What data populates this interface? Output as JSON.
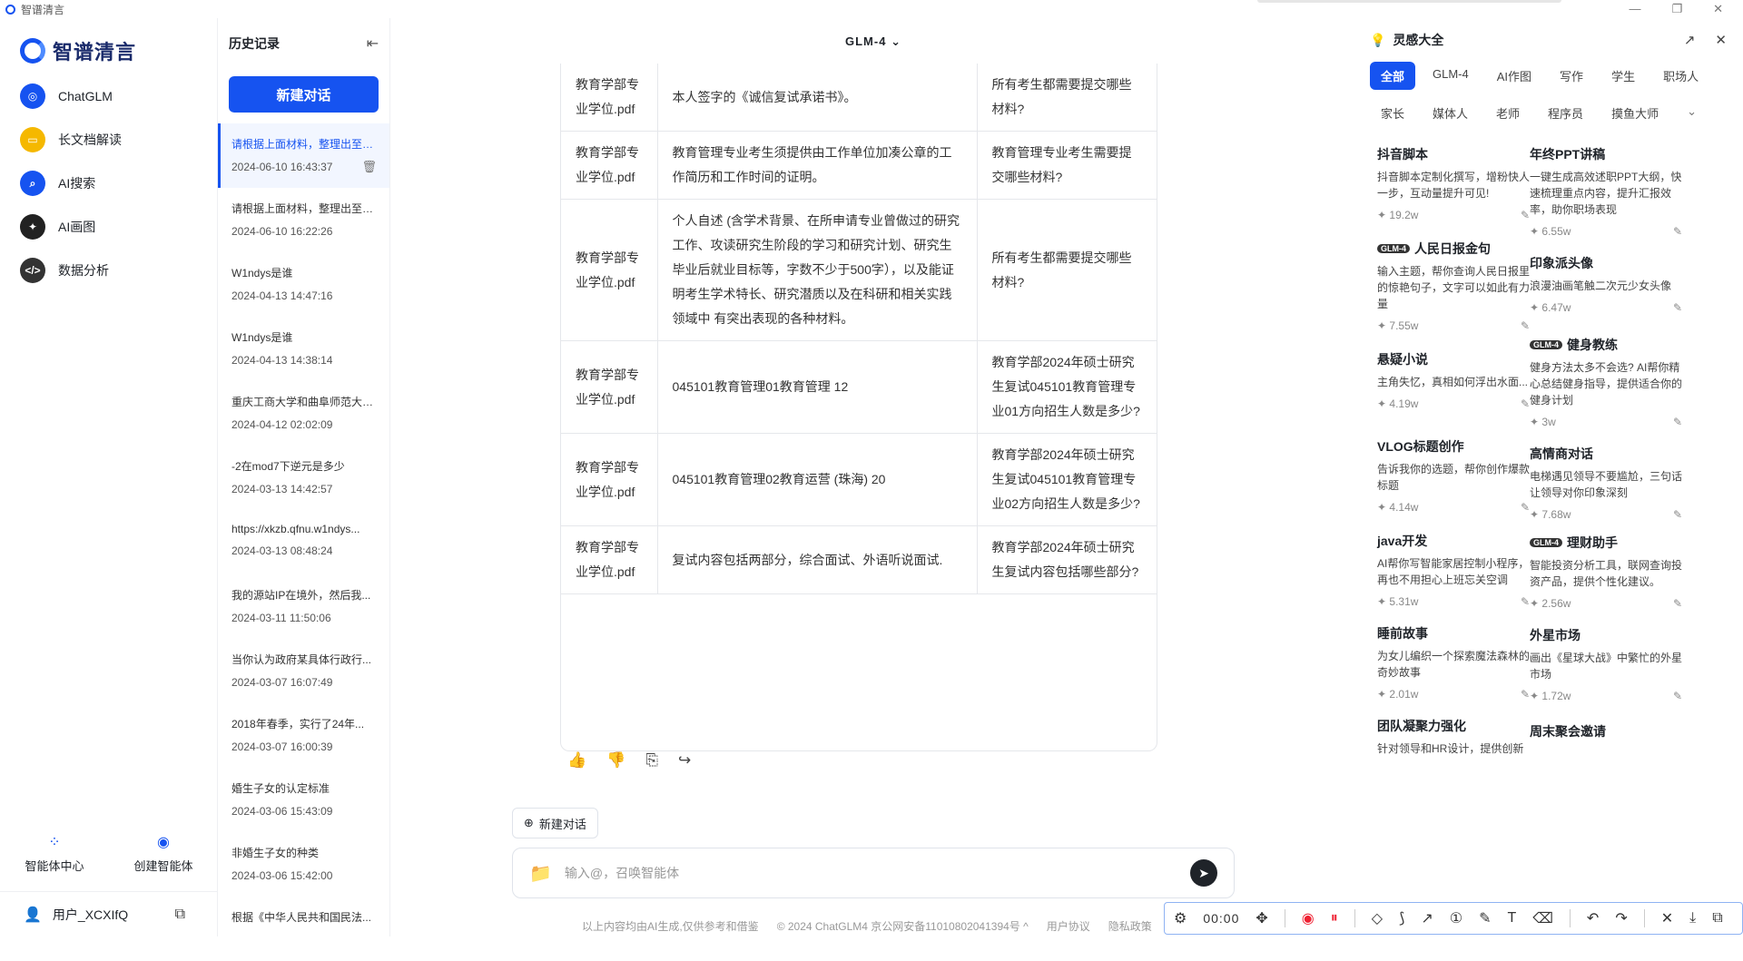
{
  "window": {
    "title": "智谱清言",
    "min": "—",
    "restore": "❐",
    "close": "✕"
  },
  "nav": {
    "brand": "智谱清言",
    "items": [
      {
        "label": "ChatGLM",
        "icon": "chatglm-icon",
        "color": "#1653f0"
      },
      {
        "label": "长文档解读",
        "icon": "folder-icon",
        "color": "#f5b800"
      },
      {
        "label": "AI搜索",
        "icon": "search-icon",
        "color": "#1653f0"
      },
      {
        "label": "AI画图",
        "icon": "paint-icon",
        "color": "#222222"
      },
      {
        "label": "数据分析",
        "icon": "code-icon",
        "color": "#333333"
      }
    ],
    "tools": [
      {
        "label": "智能体中心",
        "icon": "agents-grid-icon"
      },
      {
        "label": "创建智能体",
        "icon": "create-agent-icon"
      }
    ],
    "user": {
      "name": "用户_XCXIfQ"
    }
  },
  "history": {
    "title": "历史记录",
    "new_chat": "新建对话",
    "items": [
      {
        "title": "请根据上面材料，整理出至少...",
        "date": "2024-06-10 16:43:37"
      },
      {
        "title": "请根据上面材料，整理出至少...",
        "date": "2024-06-10 16:22:26"
      },
      {
        "title": "W1ndys是谁",
        "date": "2024-04-13 14:47:16"
      },
      {
        "title": "W1ndys是谁",
        "date": "2024-04-13 14:38:14"
      },
      {
        "title": "重庆工商大学和曲阜师范大学...",
        "date": "2024-04-12 02:02:09"
      },
      {
        "title": "-2在mod7下逆元是多少",
        "date": "2024-03-13 14:42:57"
      },
      {
        "title": "https://xkzb.qfnu.w1ndys...",
        "date": "2024-03-13 08:48:24"
      },
      {
        "title": "我的源站IP在境外，然后我...",
        "date": "2024-03-11 11:50:06"
      },
      {
        "title": "当你认为政府某具体行政行...",
        "date": "2024-03-07 16:07:49"
      },
      {
        "title": "2018年春季，实行了24年...",
        "date": "2024-03-07 16:00:39"
      },
      {
        "title": "婚生子女的认定标准",
        "date": "2024-03-06 15:43:09"
      },
      {
        "title": "非婚生子女的种类",
        "date": "2024-03-06 15:42:00"
      },
      {
        "title": "根据《中华人民共和国民法...",
        "date": ""
      }
    ]
  },
  "main": {
    "model": "GLM-4",
    "rows": [
      {
        "src": "教育学部专业学位.pdf",
        "content": "本人签字的《诚信复试承诺书》。",
        "q": "所有考生都需要提交哪些材料?"
      },
      {
        "src": "教育学部专业学位.pdf",
        "content": "教育管理专业考生须提供由工作单位加凑公章的工作简历和工作时间的证明。",
        "q": "教育管理专业考生需要提交哪些材料?"
      },
      {
        "src": "教育学部专业学位.pdf",
        "content": "个人自述 (含学术背景、在所申请专业曾做过的研究工作、攻读研究生阶段的学习和研究计划、研究生毕业后就业目标等，字数不少于500字），以及能证明考生学术特长、研究潜质以及在科研和相关实践领域中 有突出表现的各种材料。",
        "q": "所有考生都需要提交哪些材料?"
      },
      {
        "src": "教育学部专业学位.pdf",
        "content": "045101教育管理01教育管理 12",
        "q": "教育学部2024年硕士研究生复试045101教育管理专业01方向招生人数是多少?"
      },
      {
        "src": "教育学部专业学位.pdf",
        "content": "045101教育管理02教育运营 (珠海) 20",
        "q": "教育学部2024年硕士研究生复试045101教育管理专业02方向招生人数是多少?"
      },
      {
        "src": "教育学部专业学位.pdf",
        "content": "复试内容包括两部分，综合面试、外语听说面试.",
        "q": "教育学部2024年硕士研究生复试内容包括哪些部分?"
      }
    ],
    "new_chat": "新建对话",
    "input_placeholder": "输入@，召唤智能体",
    "footer": [
      "以上内容均由AI生成,仅供参考和借鉴",
      "© 2024 ChatGLM4 京公网安备11010802041394号 ^",
      "用户协议",
      "隐私政策"
    ]
  },
  "inspiration": {
    "title": "灵感大全",
    "tags": [
      "全部",
      "GLM-4",
      "AI作图",
      "写作",
      "学生",
      "职场人",
      "家长",
      "媒体人",
      "老师",
      "程序员",
      "摸鱼大师"
    ],
    "cards_left": [
      {
        "title": "抖音脚本",
        "desc": "抖音脚本定制化撰写，增粉快人一步，互动量提升可见!",
        "count": "19.2w",
        "glm": false
      },
      {
        "title": "人民日报金句",
        "desc": "输入主题，帮你查询人民日报里的惊艳句子，文字可以如此有力量",
        "count": "7.55w",
        "glm": true
      },
      {
        "title": "悬疑小说",
        "desc": "主角失忆，真相如何浮出水面...",
        "count": "4.19w",
        "glm": false
      },
      {
        "title": "VLOG标题创作",
        "desc": "告诉我你的选题，帮你创作爆款标题",
        "count": "4.14w",
        "glm": false
      },
      {
        "title": "java开发",
        "desc": "AI帮你写智能家居控制小程序，再也不用担心上班忘关空调",
        "count": "5.31w",
        "glm": false
      },
      {
        "title": "睡前故事",
        "desc": "为女儿编织一个探索魔法森林的奇妙故事",
        "count": "2.01w",
        "glm": false
      },
      {
        "title": "团队凝聚力强化",
        "desc": "针对领导和HR设计，提供创新",
        "count": "",
        "glm": false
      }
    ],
    "cards_right": [
      {
        "title": "年终PPT讲稿",
        "desc": "一键生成高效述职PPT大纲，快速梳理重点内容，提升汇报效率，助你职场表现",
        "count": "6.55w",
        "glm": false
      },
      {
        "title": "印象派头像",
        "desc": "浪漫油画笔触二次元少女头像",
        "count": "6.47w",
        "glm": false
      },
      {
        "title": "健身教练",
        "desc": "健身方法太多不会选? AI帮你精心总结健身指导，提供适合你的健身计划",
        "count": "3w",
        "glm": true
      },
      {
        "title": "高情商对话",
        "desc": "电梯遇见领导不要尴尬，三句话让领导对你印象深刻",
        "count": "7.68w",
        "glm": false
      },
      {
        "title": "理财助手",
        "desc": "智能投资分析工具，联网查询投资产品，提供个性化建议。",
        "count": "2.56w",
        "glm": true
      },
      {
        "title": "外星市场",
        "desc": "画出《星球大战》中繁忙的外星市场",
        "count": "1.72w",
        "glm": false
      },
      {
        "title": "周末聚会邀请",
        "desc": "",
        "count": "",
        "glm": false
      }
    ],
    "glm_badge": "GLM-4"
  },
  "annotation_toolbar": {
    "timer": "00:00"
  }
}
